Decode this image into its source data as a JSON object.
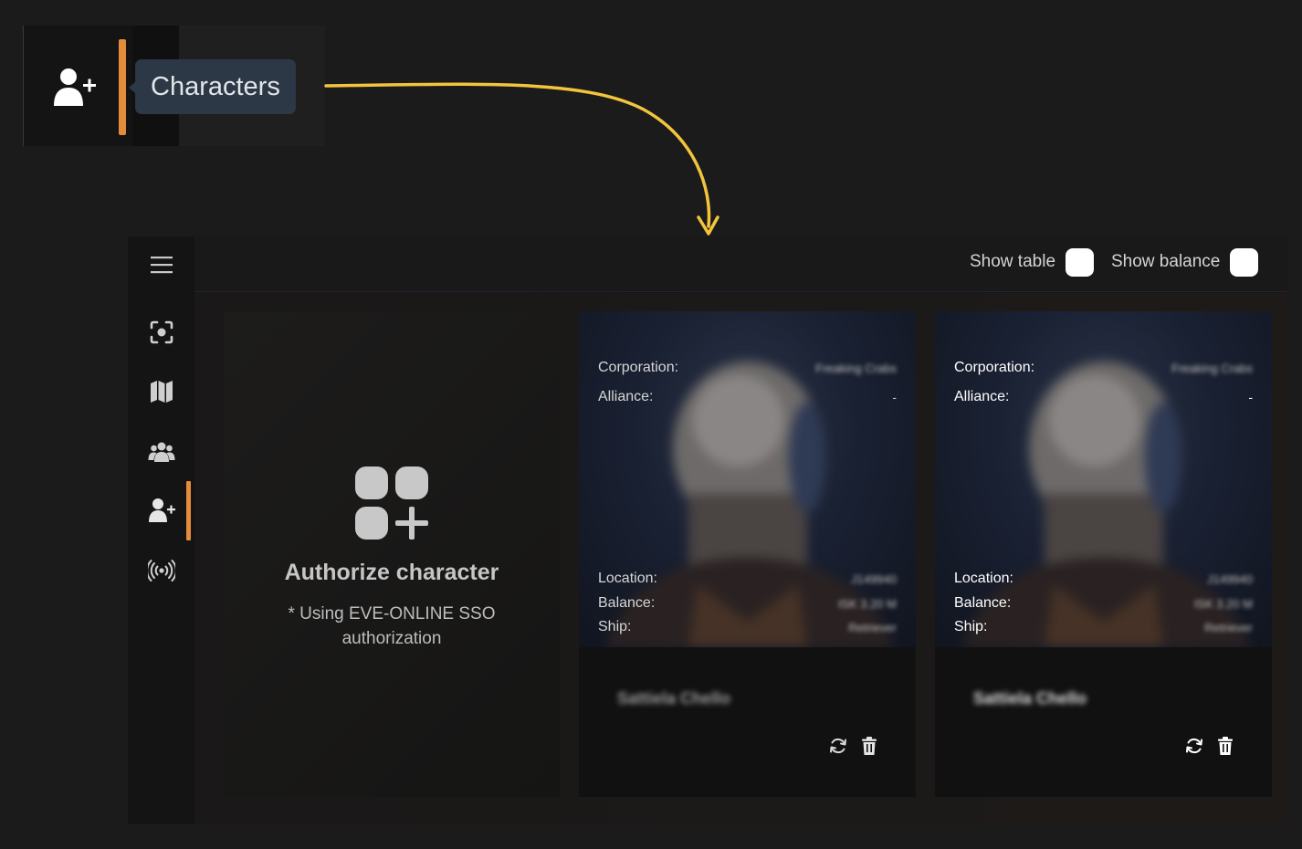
{
  "callout": {
    "tooltip": "Characters",
    "icon": "user-plus-icon"
  },
  "topbar": {
    "show_table_label": "Show table",
    "show_balance_label": "Show balance"
  },
  "sidebar": {
    "items": [
      {
        "icon": "target-scan-icon"
      },
      {
        "icon": "map-icon"
      },
      {
        "icon": "users-group-icon"
      },
      {
        "icon": "user-plus-icon",
        "active": true
      },
      {
        "icon": "broadcast-signal-icon"
      }
    ]
  },
  "auth_card": {
    "title": "Authorize character",
    "subtitle": "* Using EVE-ONLINE SSO authorization"
  },
  "characters": [
    {
      "corporation_label": "Corporation:",
      "corporation_value": "Freaking Crabs",
      "alliance_label": "Alliance:",
      "alliance_value": "-",
      "location_label": "Location:",
      "location_value": "J149940",
      "balance_label": "Balance:",
      "balance_value": "ISK 3.20 M",
      "ship_label": "Ship:",
      "ship_value": "Retriever",
      "name": "Sattiela Chello"
    },
    {
      "corporation_label": "Corporation:",
      "corporation_value": "Freaking Crabs",
      "alliance_label": "Alliance:",
      "alliance_value": "-",
      "location_label": "Location:",
      "location_value": "J149940",
      "balance_label": "Balance:",
      "balance_value": "ISK 3.20 M",
      "ship_label": "Ship:",
      "ship_value": "Retriever",
      "name": "Sattiela Chello"
    }
  ],
  "colors": {
    "accent": "#e58c3a",
    "arrow": "#f2c53d",
    "tooltip_bg": "#2c3846"
  }
}
